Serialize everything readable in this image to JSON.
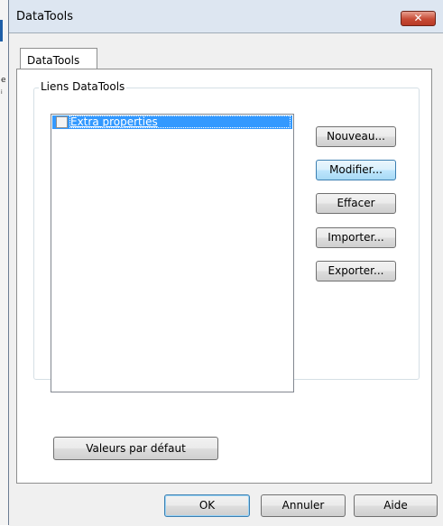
{
  "window": {
    "title": "DataTools",
    "close_glyph": "✕"
  },
  "desktop": {
    "fragment_1": "e",
    "fragment_2": "i"
  },
  "tabs": [
    {
      "label": "DataTools",
      "selected": true
    }
  ],
  "group": {
    "title": "Liens DataTools",
    "items": [
      {
        "label": "Extra properties",
        "checked": false,
        "selected": true
      }
    ]
  },
  "side_buttons": {
    "new": "Nouveau...",
    "edit": "Modifier...",
    "delete": "Effacer",
    "import": "Importer...",
    "export": "Exporter..."
  },
  "defaults_button": "Valeurs par défaut",
  "footer": {
    "ok": "OK",
    "cancel": "Annuler",
    "help": "Aide"
  },
  "colors": {
    "selection": "#3399ff",
    "close_button": "#c74a35",
    "title_bar": "#dde6f1"
  }
}
